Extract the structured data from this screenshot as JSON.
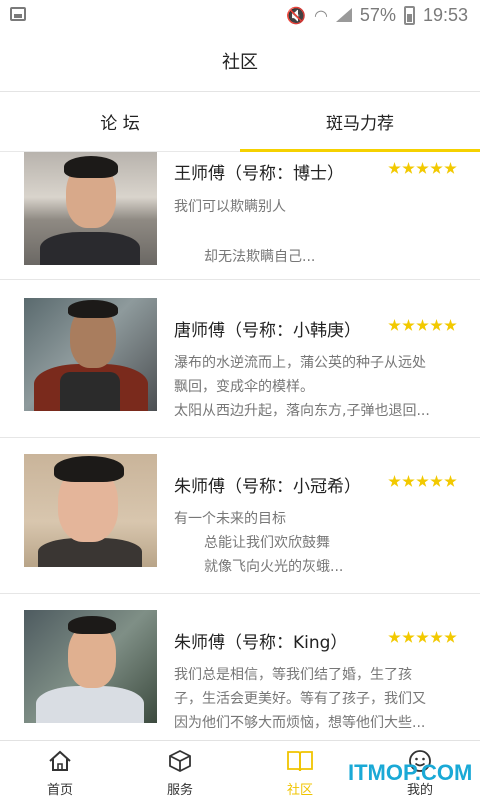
{
  "status_bar": {
    "battery_text": "57%",
    "time": "19:53"
  },
  "header": {
    "title": "社区"
  },
  "tabs": [
    {
      "label": "论 坛",
      "active": false
    },
    {
      "label": "斑马力荐",
      "active": true
    }
  ],
  "masters": [
    {
      "name": "王师傅（号称：博士）",
      "rating": 5,
      "lines": [
        "我们可以欺瞒别人",
        "",
        "却无法欺瞒自己..."
      ]
    },
    {
      "name": "唐师傅（号称：小韩庚）",
      "rating": 5,
      "lines": [
        "瀑布的水逆流而上，蒲公英的种子从远处",
        "飘回，变成伞的模样。",
        "太阳从西边升起，落向东方,子弹也退回..."
      ]
    },
    {
      "name": "朱师傅（号称：小冠希）",
      "rating": 5,
      "lines": [
        "有一个未来的目标",
        "总能让我们欢欣鼓舞",
        "就像飞向火光的灰蛾..."
      ]
    },
    {
      "name": "朱师傅（号称：King）",
      "rating": 5,
      "lines": [
        "我们总是相信，等我们结了婚，生了孩",
        "子，生活会更美好。等有了孩子，我们又",
        "因为他们不够大而烦恼，想等他们大些..."
      ]
    }
  ],
  "bottom_nav": [
    {
      "label": "首页",
      "icon": "home-icon",
      "active": false
    },
    {
      "label": "服务",
      "icon": "box-icon",
      "active": false
    },
    {
      "label": "社区",
      "icon": "book-icon",
      "active": true
    },
    {
      "label": "我的",
      "icon": "smiley-icon",
      "active": false
    }
  ],
  "watermark": "ITMOP.COM",
  "colors": {
    "accent": "#f5d100",
    "star": "#f2c900",
    "watermark": "#1aa9d6"
  }
}
